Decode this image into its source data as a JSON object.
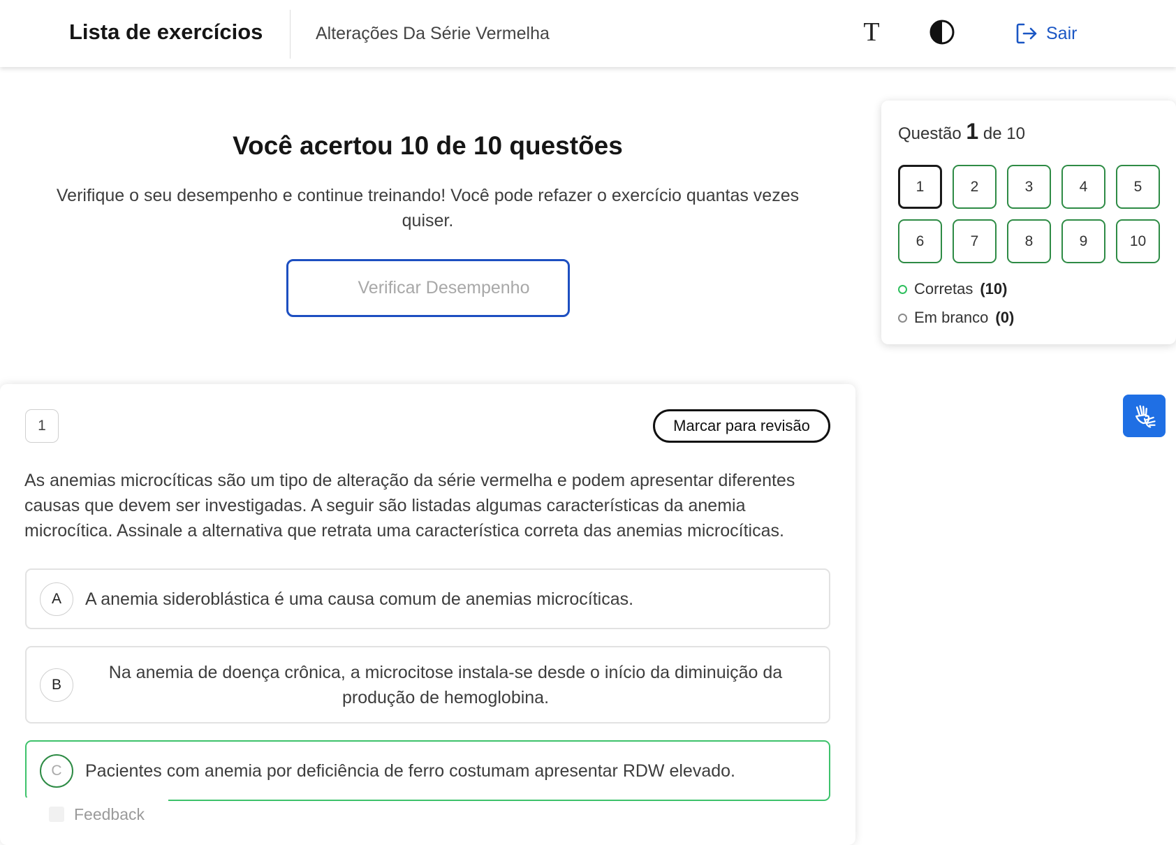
{
  "header": {
    "app_title": "Lista de exercícios",
    "subtitle": "Alterações Da Série Vermelha",
    "font_size_icon": "T",
    "logout_label": "Sair"
  },
  "result": {
    "title": "Você acertou 10 de 10 questões",
    "description": "Verifique o seu desempenho e continue treinando! Você pode refazer o exercício quantas vezes quiser.",
    "verify_button": "Verificar Desempenho"
  },
  "navigator": {
    "label_prefix": "Questão",
    "current": "1",
    "label_suffix": "de 10",
    "questions": [
      "1",
      "2",
      "3",
      "4",
      "5",
      "6",
      "7",
      "8",
      "9",
      "10"
    ],
    "legend": [
      {
        "label": "Corretas",
        "count": "(10)"
      },
      {
        "label": "Em branco",
        "count": "(0)"
      }
    ]
  },
  "question": {
    "number": "1",
    "review_button": "Marcar para revisão",
    "statement": "As anemias microcíticas são um tipo de alteração da série vermelha e podem apresentar diferentes causas que devem ser investigadas. A seguir são listadas algumas características da anemia microcítica. Assinale a alternativa que retrata uma característica correta das anemias microcíticas.",
    "options": [
      {
        "letter": "A",
        "text": "A anemia sideroblástica é uma causa comum de anemias microcíticas."
      },
      {
        "letter": "B",
        "text": "Na anemia de doença crônica, a microcitose instala-se desde o início da diminuição da produção de hemoglobina."
      },
      {
        "letter": "C",
        "text": "Pacientes com anemia por deficiência de ferro costumam apresentar RDW elevado."
      }
    ]
  },
  "feedback_label": "Feedback",
  "colors": {
    "accent_blue": "#1d4fc1",
    "correct_green": "#3dc26b",
    "libras_blue": "#1f6fe4"
  }
}
